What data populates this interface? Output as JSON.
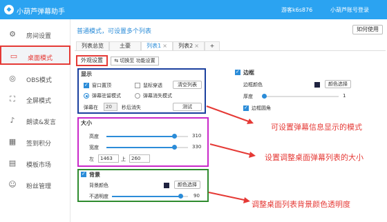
{
  "app": {
    "title": "小葫芦弹幕助手",
    "user": "游客k6s876",
    "login": "小葫芦账号登录"
  },
  "sidebar": {
    "items": [
      {
        "label": "房间设置",
        "icon": "gear-icon"
      },
      {
        "label": "桌面模式",
        "icon": "monitor-icon",
        "active": true
      },
      {
        "label": "OBS模式",
        "icon": "obs-icon"
      },
      {
        "label": "全屏模式",
        "icon": "fullscreen-icon"
      },
      {
        "label": "朗读&发言",
        "icon": "microphone-icon"
      },
      {
        "label": "签到积分",
        "icon": "calendar-icon"
      },
      {
        "label": "模板市场",
        "icon": "template-icon"
      },
      {
        "label": "粉丝管理",
        "icon": "fans-icon"
      }
    ]
  },
  "header": {
    "mode_text": "普通模式，可设置多个列表",
    "help": "如何使用"
  },
  "tabs": [
    {
      "label": "列表总览"
    },
    {
      "label": "土豪"
    },
    {
      "label": "列表1",
      "active": true,
      "close": "×"
    },
    {
      "label": "列表2",
      "close": "×"
    },
    {
      "label": "+"
    }
  ],
  "subtabs": {
    "appearance": "外观设置",
    "switch": "切换至 功能设置"
  },
  "display": {
    "title": "显示",
    "window_top": "窗口置顶",
    "mouse_through": "鼠标穿透",
    "clear_list": "清空列表",
    "mode_stay": "弹幕驻留模式",
    "mode_fade": "弹幕消失模式",
    "fade_prefix": "弹幕在",
    "fade_value": "20",
    "fade_suffix": "秒后消失",
    "test": "测试"
  },
  "size": {
    "title": "大小",
    "height_label": "高度",
    "height_value": "310",
    "height_fraction": 0.83,
    "width_label": "宽度",
    "width_value": "330",
    "width_fraction": 0.83,
    "left_label": "左",
    "left_value": "1463",
    "top_label": "上",
    "top_value": "260"
  },
  "background": {
    "title": "背景",
    "color_label": "背景颜色",
    "color_btn": "颜色选择",
    "color": "#1f2340",
    "opacity_label": "不透明度",
    "opacity_value": "90",
    "opacity_fraction": 0.9
  },
  "border": {
    "title": "边框",
    "color_label": "边框颜色",
    "color_btn": "颜色选择",
    "color": "#1f2340",
    "thickness_label": "厚度",
    "thickness_value": "1",
    "thickness_fraction": 0.02,
    "rounded": "边框圆角"
  },
  "annotations": {
    "a1": "可设置弹幕信息显示的模式",
    "a2": "设置调整桌面弹幕列表的大小",
    "a3": "调整桌面列表背景颜色透明度"
  },
  "colors": {
    "brand": "#2ba3f1",
    "accent": "#2b8cd8",
    "annot": "#e53935",
    "box_display": "#1a3f9e",
    "box_size": "#c928c9",
    "box_bg": "#2e8b2e"
  }
}
